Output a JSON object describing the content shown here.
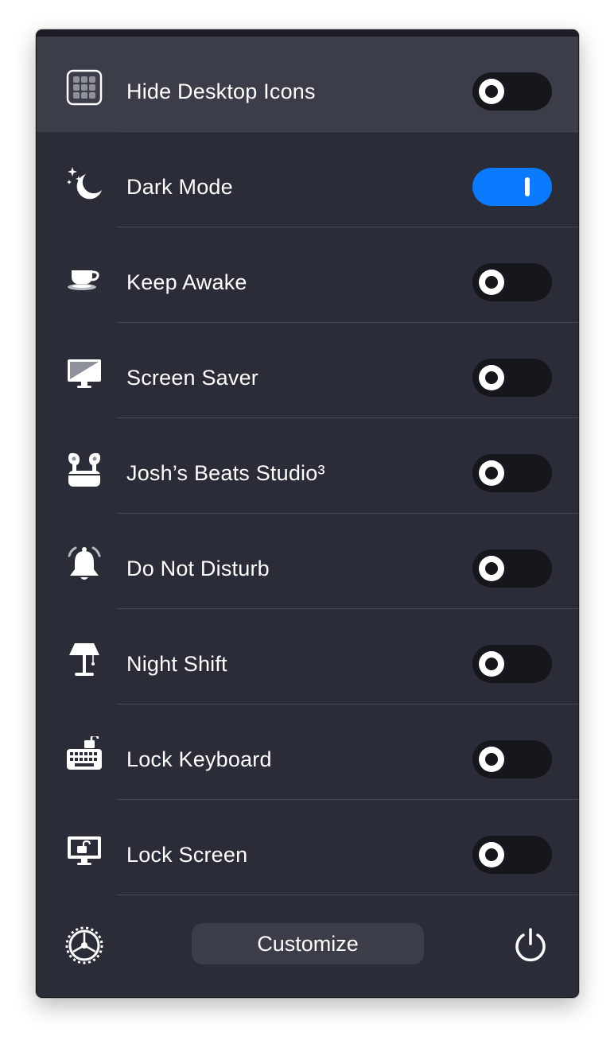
{
  "menu": {
    "items": [
      {
        "label": "Hide Desktop Icons",
        "icon": "desktop-icons-grid-icon",
        "on": false
      },
      {
        "label": "Dark Mode",
        "icon": "moon-stars-icon",
        "on": true
      },
      {
        "label": "Keep Awake",
        "icon": "coffee-cup-icon",
        "on": false
      },
      {
        "label": "Screen Saver",
        "icon": "monitor-icon",
        "on": false
      },
      {
        "label": "Josh’s Beats Studio³",
        "icon": "earbuds-icon",
        "on": false
      },
      {
        "label": "Do Not Disturb",
        "icon": "bell-icon",
        "on": false
      },
      {
        "label": "Night Shift",
        "icon": "lamp-icon",
        "on": false
      },
      {
        "label": "Lock Keyboard",
        "icon": "keyboard-lock-icon",
        "on": false
      },
      {
        "label": "Lock Screen",
        "icon": "screen-lock-icon",
        "on": false
      }
    ]
  },
  "footer": {
    "settings_icon": "gear-icon",
    "customize_label": "Customize",
    "power_icon": "power-icon"
  },
  "colors": {
    "panel": "#2a2c37",
    "highlight": "#3b3e48",
    "accent": "#0a7aff",
    "toggle_off": "#16171c"
  }
}
